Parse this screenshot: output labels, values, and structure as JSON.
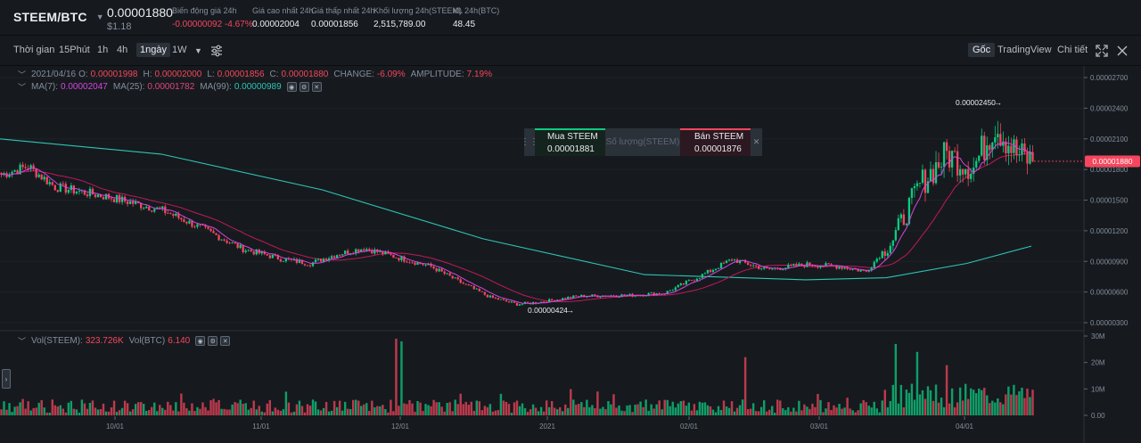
{
  "ticker": {
    "pair": "STEEM/BTC",
    "last_price": "0.00001880",
    "last_usd": "$1.18",
    "stats": [
      {
        "label": "Biến động giá 24h",
        "value": "-0.00000092 -4.67%",
        "negative": true
      },
      {
        "label": "Giá cao nhất 24h",
        "value": "0.00002004",
        "negative": false
      },
      {
        "label": "Giá thấp nhất 24h",
        "value": "0.00001856",
        "negative": false
      },
      {
        "label": "Khối lượng 24h(STEEM)",
        "value": "2,515,789.00",
        "negative": false
      },
      {
        "label": "KL 24h(BTC)",
        "value": "48.45",
        "negative": false
      }
    ]
  },
  "toolbar": {
    "timeframes": [
      "Thời gian",
      "15Phút",
      "1h",
      "4h",
      "1ngày",
      "1W"
    ],
    "active_timeframe": "1ngày",
    "views": [
      "Gốc",
      "TradingView",
      "Chi tiết"
    ],
    "active_view": "Gốc"
  },
  "ohlc": {
    "date": "2021/04/16",
    "o_label": "O:",
    "o": "0.00001998",
    "h_label": "H:",
    "h": "0.00002000",
    "l_label": "L:",
    "l": "0.00001856",
    "c_label": "C:",
    "c": "0.00001880",
    "change_label": "CHANGE:",
    "change": "-6.09%",
    "amplitude_label": "AMPLITUDE:",
    "amplitude": "7.19%"
  },
  "ma": {
    "ma7_label": "MA(7):",
    "ma7": "0.00002047",
    "ma25_label": "MA(25):",
    "ma25": "0.00001782",
    "ma99_label": "MA(99):",
    "ma99": "0.00000989"
  },
  "volume_info": {
    "vol_label": "Vol(STEEM):",
    "vol": "323.726K",
    "volbtc_label": "Vol(BTC)",
    "volbtc": "6.140"
  },
  "order_widget": {
    "buy_label": "Mua STEEM",
    "buy_price": "0.00001881",
    "qty_placeholder": "Số lượng(STEEM)",
    "sell_label": "Bán STEEM",
    "sell_price": "0.00001876"
  },
  "colors": {
    "up": "#0ecb81",
    "down": "#f6465d",
    "ma7": "#d445e0",
    "ma25": "#c2185b",
    "ma99": "#2ec4b6",
    "bg": "#161a1e"
  },
  "chart_data": {
    "type": "candlestick",
    "price_axis_ticks": [
      "0.00002700",
      "0.00002400",
      "0.00002100",
      "0.00001800",
      "0.00001500",
      "0.00001200",
      "0.00000900",
      "0.00000600",
      "0.00000300"
    ],
    "volume_axis_ticks": [
      "30M",
      "20M",
      "10M",
      "0.00"
    ],
    "x_tick_labels": [
      "10/01",
      "11/01",
      "12/01",
      "2021",
      "02/01",
      "03/01",
      "04/01"
    ],
    "current_price_label": "0.00001880",
    "max_label": "0.00002450",
    "min_label": "0.00000424",
    "ylim": [
      1.9e-06,
      2.8e-06
    ],
    "anchors": [
      {
        "t": 0,
        "p": 1.75e-05
      },
      {
        "t": 10,
        "p": 1.83e-05
      },
      {
        "t": 20,
        "p": 1.63e-05
      },
      {
        "t": 40,
        "p": 1.53e-05
      },
      {
        "t": 60,
        "p": 1.4e-05
      },
      {
        "t": 75,
        "p": 1.22e-05
      },
      {
        "t": 90,
        "p": 1.02e-05
      },
      {
        "t": 105,
        "p": 9.2e-06
      },
      {
        "t": 115,
        "p": 8.8e-06
      },
      {
        "t": 125,
        "p": 9.7e-06
      },
      {
        "t": 135,
        "p": 1.03e-05
      },
      {
        "t": 150,
        "p": 9.2e-06
      },
      {
        "t": 160,
        "p": 8.5e-06
      },
      {
        "t": 172,
        "p": 6.8e-06
      },
      {
        "t": 182,
        "p": 5.5e-06
      },
      {
        "t": 192,
        "p": 4.8e-06
      },
      {
        "t": 200,
        "p": 5e-06
      },
      {
        "t": 215,
        "p": 5.6e-06
      },
      {
        "t": 235,
        "p": 5.7e-06
      },
      {
        "t": 247,
        "p": 5.9e-06
      },
      {
        "t": 262,
        "p": 7.8e-06
      },
      {
        "t": 272,
        "p": 9.2e-06
      },
      {
        "t": 285,
        "p": 8.2e-06
      },
      {
        "t": 300,
        "p": 8.7e-06
      },
      {
        "t": 312,
        "p": 8.5e-06
      },
      {
        "t": 322,
        "p": 8e-06
      },
      {
        "t": 332,
        "p": 1.12e-05
      },
      {
        "t": 342,
        "p": 1.65e-05
      },
      {
        "t": 352,
        "p": 1.95e-05
      },
      {
        "t": 362,
        "p": 1.82e-05
      },
      {
        "t": 370,
        "p": 2.25e-05
      },
      {
        "t": 378,
        "p": 1.95e-05
      },
      {
        "t": 384,
        "p": 1.88e-05
      }
    ],
    "ma99_points": [
      [
        0,
        2.1e-05
      ],
      [
        60,
        1.95e-05
      ],
      [
        120,
        1.6e-05
      ],
      [
        180,
        1.12e-05
      ],
      [
        240,
        7.7e-06
      ],
      [
        300,
        7.2e-06
      ],
      [
        330,
        7.4e-06
      ],
      [
        360,
        8.8e-06
      ],
      [
        384,
        1.05e-05
      ]
    ],
    "volume_spikes": [
      {
        "t": 147,
        "v": 29
      },
      {
        "t": 149,
        "v": 28
      },
      {
        "t": 333,
        "v": 27
      },
      {
        "t": 341,
        "v": 24
      },
      {
        "t": 352,
        "v": 19
      },
      {
        "t": 228,
        "v": 8
      },
      {
        "t": 277,
        "v": 22
      }
    ]
  }
}
